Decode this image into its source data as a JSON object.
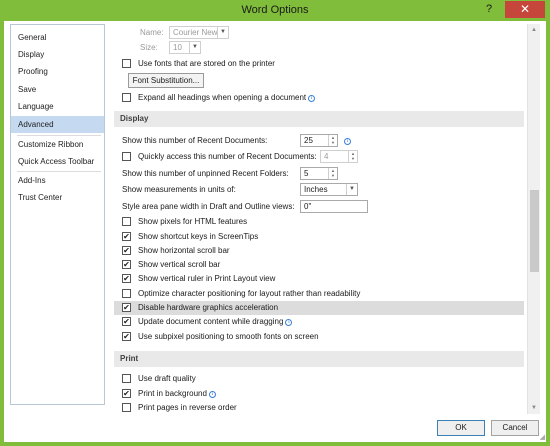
{
  "window": {
    "title": "Word Options",
    "help_glyph": "?",
    "close_glyph": "✕"
  },
  "nav": {
    "items": [
      {
        "label": "General"
      },
      {
        "label": "Display"
      },
      {
        "label": "Proofing"
      },
      {
        "label": "Save"
      },
      {
        "label": "Language"
      },
      {
        "label": "Advanced",
        "selected": true
      },
      {
        "label": "Customize Ribbon"
      },
      {
        "label": "Quick Access Toolbar"
      },
      {
        "label": "Add-Ins"
      },
      {
        "label": "Trust Center"
      }
    ]
  },
  "font_subst": {
    "name_label": "Name:",
    "name_value": "Courier New",
    "size_label": "Size:",
    "size_value": "10",
    "use_printer_fonts": {
      "label": "Use fonts that are stored on the printer",
      "checked": false
    },
    "font_substitution_button": "Font Substitution...",
    "expand_headings": {
      "label": "Expand all headings when opening a document",
      "checked": false
    }
  },
  "display": {
    "header": "Display",
    "recent_docs": {
      "label": "Show this number of Recent Documents:",
      "value": "25"
    },
    "quick_access": {
      "label": "Quickly access this number of Recent Documents:",
      "value": "4",
      "checked": false
    },
    "unpinned_folders": {
      "label": "Show this number of unpinned Recent Folders:",
      "value": "5"
    },
    "units": {
      "label": "Show measurements in units of:",
      "value": "Inches"
    },
    "style_area": {
      "label": "Style area pane width in Draft and Outline views:",
      "value": "0\""
    },
    "checks": [
      {
        "label": "Show pixels for HTML features",
        "checked": false
      },
      {
        "label": "Show shortcut keys in ScreenTips",
        "checked": true
      },
      {
        "label": "Show horizontal scroll bar",
        "checked": true
      },
      {
        "label": "Show vertical scroll bar",
        "checked": true
      },
      {
        "label": "Show vertical ruler in Print Layout view",
        "checked": true
      },
      {
        "label": "Optimize character positioning for layout rather than readability",
        "checked": false
      },
      {
        "label": "Disable hardware graphics acceleration",
        "checked": true,
        "highlighted": true
      },
      {
        "label": "Update document content while dragging",
        "checked": true,
        "info": true
      },
      {
        "label": "Use subpixel positioning to smooth fonts on screen",
        "checked": true
      }
    ]
  },
  "print": {
    "header": "Print",
    "checks": [
      {
        "label": "Use draft quality",
        "checked": false
      },
      {
        "label": "Print in background",
        "checked": true,
        "info": true
      },
      {
        "label": "Print pages in reverse order",
        "checked": false
      }
    ]
  },
  "footer": {
    "ok_label": "OK",
    "cancel_label": "Cancel"
  },
  "colors": {
    "title_bar": "#7fbd3a",
    "selected_nav": "#c5daf1",
    "close_button": "#c7463c"
  },
  "check_glyph": "✔",
  "info_glyph": "i"
}
